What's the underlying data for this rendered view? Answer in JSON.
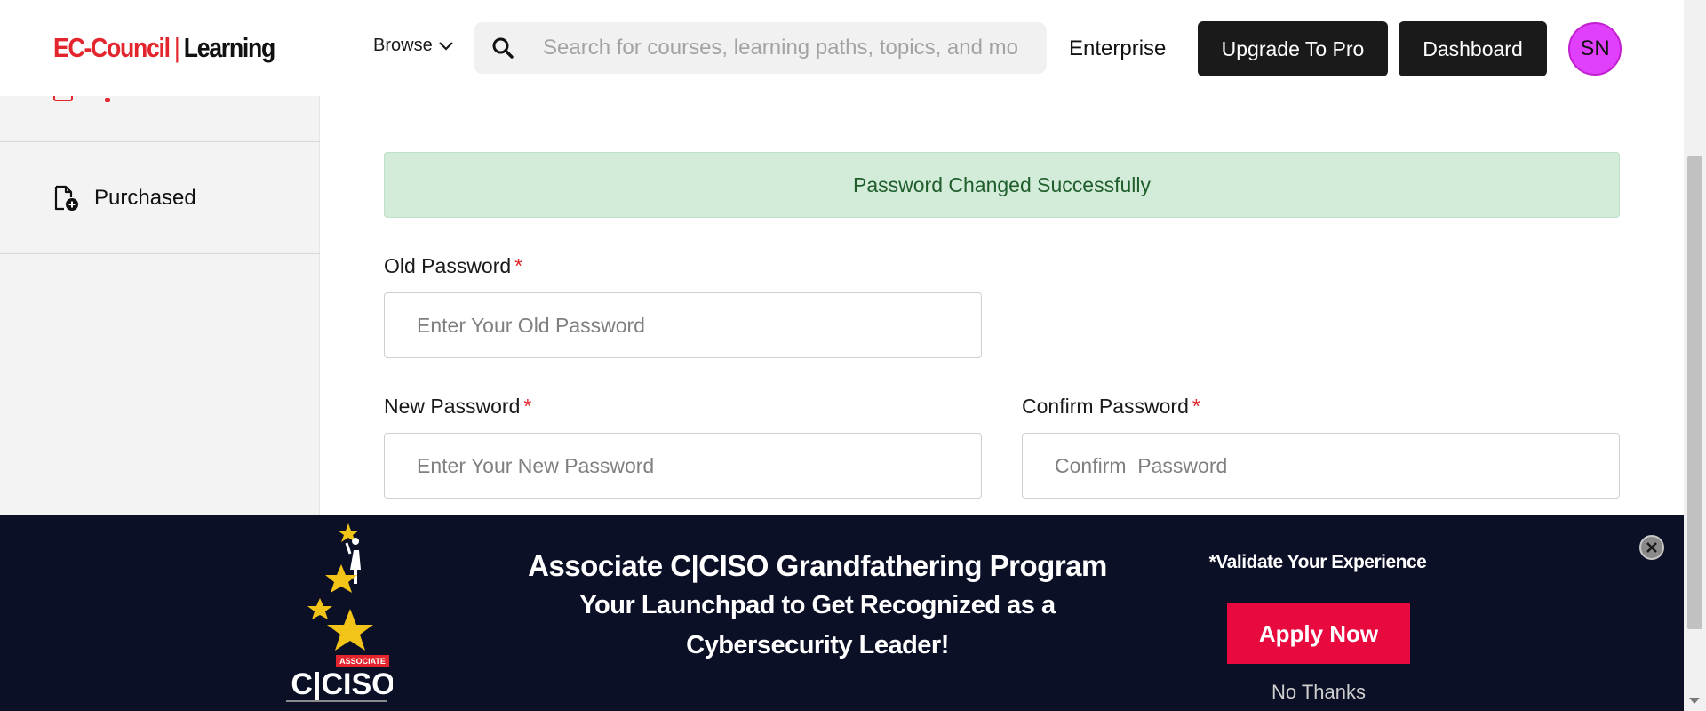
{
  "header": {
    "logo": {
      "part1": "EC-Council",
      "separator": "|",
      "part2": "Learning"
    },
    "browse_label": "Browse",
    "search_placeholder": "Search for courses, learning paths, topics, and mo",
    "enterprise_label": "Enterprise",
    "upgrade_label": "Upgrade To Pro",
    "dashboard_label": "Dashboard",
    "avatar_initials": "SN",
    "avatar_color": "#e040fb"
  },
  "sidebar": {
    "items": [
      {
        "label": "Purchased",
        "icon": "file-add-icon"
      }
    ]
  },
  "form": {
    "alert": "Password Changed Successfully",
    "old_password": {
      "label": "Old Password",
      "required": "*",
      "placeholder": "Enter Your Old Password"
    },
    "new_password": {
      "label": "New Password",
      "required": "*",
      "placeholder": "Enter Your New Password"
    },
    "confirm_password": {
      "label": "Confirm Password",
      "required": "*",
      "placeholder": "Confirm  Password"
    }
  },
  "promo": {
    "logo_badge": "ASSOCIATE",
    "logo_text": "C|CISO",
    "title": "Associate C|CISO Grandfathering Program",
    "subtitle_line1": "Your Launchpad to Get Recognized as a",
    "subtitle_line2": "Cybersecurity Leader!",
    "validate": "*Validate Your Experience",
    "apply_label": "Apply Now",
    "no_thanks_label": "No Thanks"
  },
  "colors": {
    "brand_red": "#e3262d",
    "success_bg": "#d3ecd9",
    "success_text": "#1f5e2c",
    "promo_bg": "#0c1026",
    "apply_bg": "#e8093f",
    "dark_button": "#1a1a1a"
  }
}
